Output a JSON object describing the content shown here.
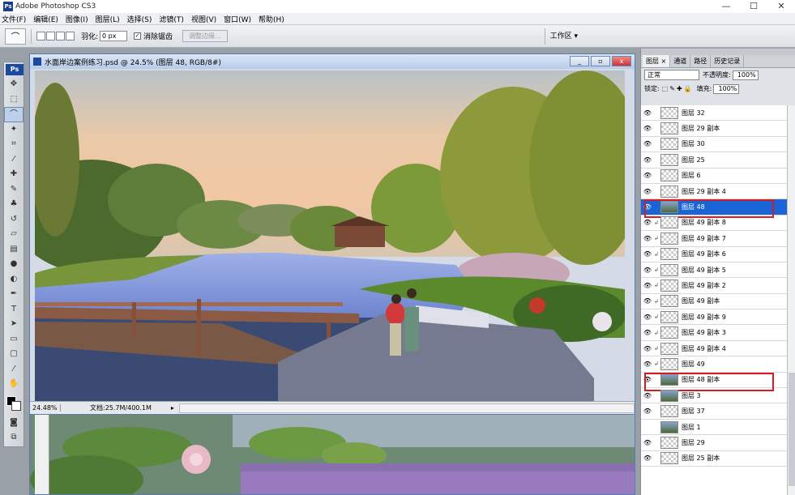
{
  "app": {
    "title": "Adobe Photoshop CS3",
    "window_controls": [
      "—",
      "☐",
      "✕"
    ]
  },
  "menu": [
    "文件(F)",
    "编辑(E)",
    "图像(I)",
    "图层(L)",
    "选择(S)",
    "滤镜(T)",
    "视图(V)",
    "窗口(W)",
    "帮助(H)"
  ],
  "options": {
    "feather_label": "羽化:",
    "feather_value": "0 px",
    "antialias_label": "消除锯齿",
    "refine_edge_label": "调整边缘...",
    "workspace_label": "工作区 ▾"
  },
  "document": {
    "title": "水面岸边案例练习.psd @ 24.5% (图层 48, RGB/8#)",
    "zoom": "24.48%",
    "doc_info": "文档:25.7M/400.1M",
    "controls": [
      "_",
      "▫",
      "x"
    ]
  },
  "layers_panel": {
    "tabs": [
      "图层 ×",
      "通道",
      "路径",
      "历史记录"
    ],
    "blend_mode": "正常",
    "opacity_label": "不透明度:",
    "opacity_value": "100%",
    "lock_label": "锁定:",
    "lock_icons": "⬚✎✚🔒",
    "fill_label": "填充:",
    "fill_value": "100%",
    "layers": [
      {
        "name": "图层 32",
        "eye": true,
        "link": false,
        "thumb": "check"
      },
      {
        "name": "图层 29 副本",
        "eye": true,
        "link": false,
        "thumb": "check"
      },
      {
        "name": "图层 30",
        "eye": true,
        "link": false,
        "thumb": "check"
      },
      {
        "name": "图层 25",
        "eye": true,
        "link": false,
        "thumb": "check"
      },
      {
        "name": "图层 6",
        "eye": true,
        "link": false,
        "thumb": "check"
      },
      {
        "name": "图层 29 副本 4",
        "eye": true,
        "link": false,
        "thumb": "check"
      },
      {
        "name": "图层 48",
        "eye": true,
        "link": false,
        "thumb": "scene",
        "selected": true,
        "outlined": true
      },
      {
        "name": "图层 49 副本 8",
        "eye": true,
        "link": true,
        "thumb": "check"
      },
      {
        "name": "图层 49 副本 7",
        "eye": true,
        "link": true,
        "thumb": "check"
      },
      {
        "name": "图层 49 副本 6",
        "eye": true,
        "link": true,
        "thumb": "check"
      },
      {
        "name": "图层 49 副本 5",
        "eye": true,
        "link": true,
        "thumb": "check"
      },
      {
        "name": "图层 49 副本 2",
        "eye": true,
        "link": true,
        "thumb": "check"
      },
      {
        "name": "图层 49 副本",
        "eye": true,
        "link": true,
        "thumb": "check"
      },
      {
        "name": "图层 49 副本 9",
        "eye": true,
        "link": true,
        "thumb": "check"
      },
      {
        "name": "图层 49 副本 3",
        "eye": true,
        "link": true,
        "thumb": "check"
      },
      {
        "name": "图层 49 副本 4",
        "eye": true,
        "link": true,
        "thumb": "check"
      },
      {
        "name": "图层 49",
        "eye": true,
        "link": true,
        "thumb": "check"
      },
      {
        "name": "图层 48 副本",
        "eye": true,
        "link": false,
        "thumb": "scene",
        "outlined": true
      },
      {
        "name": "图层 3",
        "eye": true,
        "link": false,
        "thumb": "scene"
      },
      {
        "name": "图层 37",
        "eye": true,
        "link": false,
        "thumb": "check"
      },
      {
        "name": "图层 1",
        "eye": false,
        "link": false,
        "thumb": "scene"
      },
      {
        "name": "图层 29",
        "eye": true,
        "link": false,
        "thumb": "check"
      },
      {
        "name": "图层 25 副本",
        "eye": true,
        "link": false,
        "thumb": "check"
      }
    ]
  },
  "watermark": "秋凌景观",
  "colors": {
    "selection": "#1a64d6",
    "highlight_box": "#d21d24",
    "title_bg": "#b7cbe9"
  }
}
